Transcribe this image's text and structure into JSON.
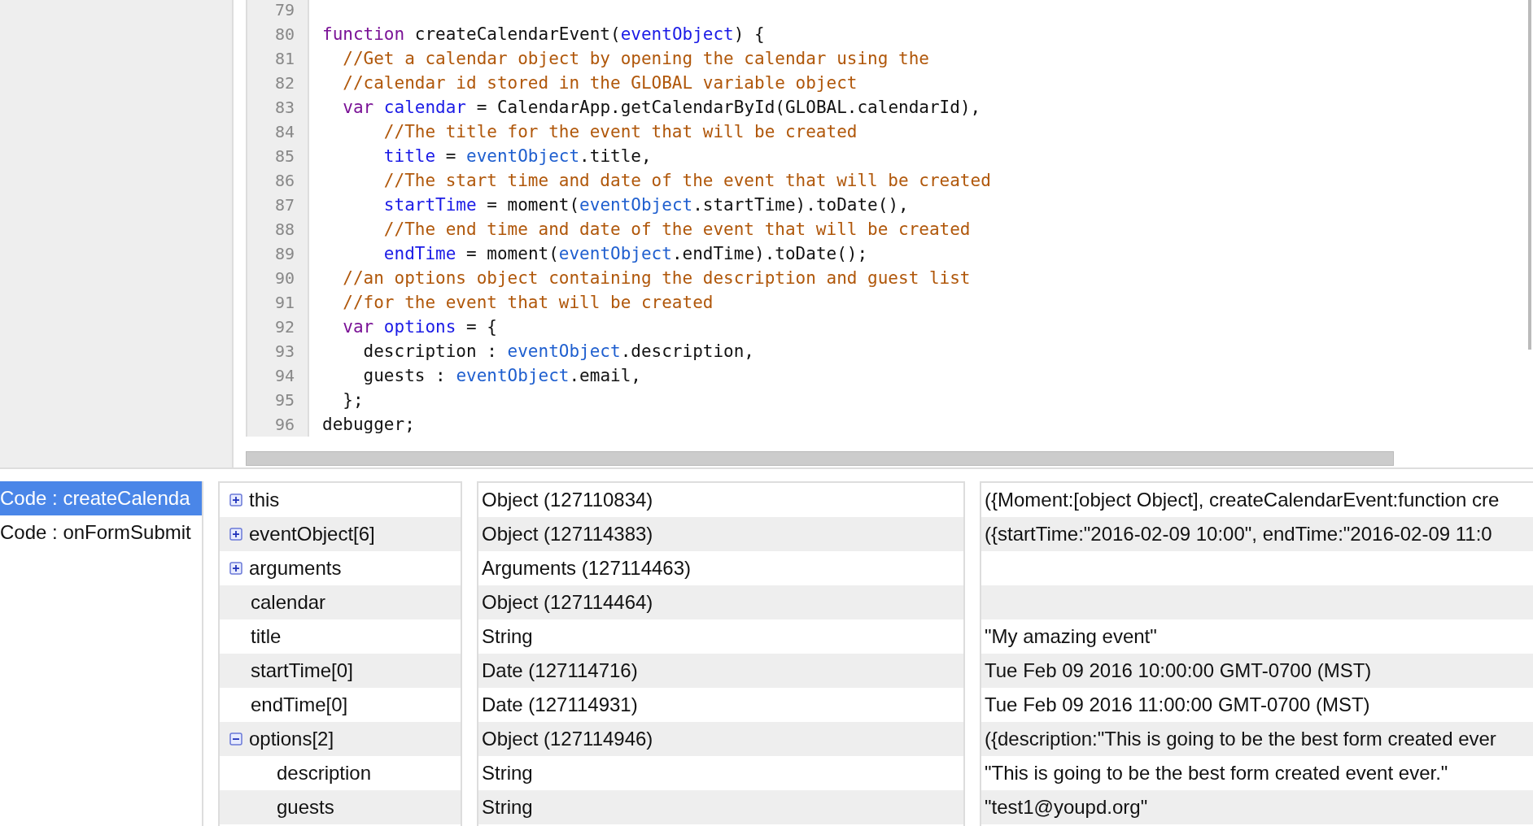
{
  "editor": {
    "lines": [
      {
        "number": "79"
      },
      {
        "number": "80",
        "tokens": [
          {
            "kind": "keyword",
            "text": "function"
          },
          {
            "kind": "plain",
            "text": " createCalendarEvent("
          },
          {
            "kind": "def",
            "text": "eventObject"
          },
          {
            "kind": "plain",
            "text": ") {"
          }
        ]
      },
      {
        "number": "81",
        "tokens": [
          {
            "kind": "comment",
            "text": "  //Get a calendar object by opening the calendar using the"
          }
        ]
      },
      {
        "number": "82",
        "tokens": [
          {
            "kind": "comment",
            "text": "  //calendar id stored in the GLOBAL variable object"
          }
        ]
      },
      {
        "number": "83",
        "tokens": [
          {
            "kind": "keyword",
            "text": "  var"
          },
          {
            "kind": "def",
            "text": " calendar"
          },
          {
            "kind": "plain",
            "text": " = CalendarApp.getCalendarById(GLOBAL.calendarId),"
          }
        ]
      },
      {
        "number": "84",
        "tokens": [
          {
            "kind": "comment",
            "text": "      //The title for the event that will be created"
          }
        ]
      },
      {
        "number": "85",
        "tokens": [
          {
            "kind": "def",
            "text": "      title"
          },
          {
            "kind": "plain",
            "text": " = "
          },
          {
            "kind": "var",
            "text": "eventObject"
          },
          {
            "kind": "plain",
            "text": ".title,"
          }
        ]
      },
      {
        "number": "86",
        "tokens": [
          {
            "kind": "comment",
            "text": "      //The start time and date of the event that will be created"
          }
        ]
      },
      {
        "number": "87",
        "tokens": [
          {
            "kind": "def",
            "text": "      startTime"
          },
          {
            "kind": "plain",
            "text": " = moment("
          },
          {
            "kind": "var",
            "text": "eventObject"
          },
          {
            "kind": "plain",
            "text": ".startTime).toDate(),"
          }
        ]
      },
      {
        "number": "88",
        "tokens": [
          {
            "kind": "comment",
            "text": "      //The end time and date of the event that will be created"
          }
        ]
      },
      {
        "number": "89",
        "tokens": [
          {
            "kind": "def",
            "text": "      endTime"
          },
          {
            "kind": "plain",
            "text": " = moment("
          },
          {
            "kind": "var",
            "text": "eventObject"
          },
          {
            "kind": "plain",
            "text": ".endTime).toDate();"
          }
        ]
      },
      {
        "number": "90",
        "tokens": [
          {
            "kind": "comment",
            "text": "  //an options object containing the description and guest list"
          }
        ]
      },
      {
        "number": "91",
        "tokens": [
          {
            "kind": "comment",
            "text": "  //for the event that will be created"
          }
        ]
      },
      {
        "number": "92",
        "tokens": [
          {
            "kind": "keyword",
            "text": "  var"
          },
          {
            "kind": "def",
            "text": " options"
          },
          {
            "kind": "plain",
            "text": " = {"
          }
        ]
      },
      {
        "number": "93",
        "tokens": [
          {
            "kind": "plain",
            "text": "    description : "
          },
          {
            "kind": "var",
            "text": "eventObject"
          },
          {
            "kind": "plain",
            "text": ".description,"
          }
        ]
      },
      {
        "number": "94",
        "tokens": [
          {
            "kind": "plain",
            "text": "    guests : "
          },
          {
            "kind": "var",
            "text": "eventObject"
          },
          {
            "kind": "plain",
            "text": ".email,"
          }
        ]
      },
      {
        "number": "95",
        "tokens": [
          {
            "kind": "plain",
            "text": "  };"
          }
        ]
      },
      {
        "number": "96",
        "tokens": [
          {
            "kind": "plain",
            "text": "debugger;"
          }
        ]
      }
    ]
  },
  "call_stack": [
    {
      "label": "Code : createCalenda",
      "selected": true
    },
    {
      "label": "Code : onFormSubmit",
      "selected": false
    }
  ],
  "variables": [
    {
      "name": "this",
      "kind": "expandable",
      "expanded": false,
      "type": "Object (127110834)",
      "value": "({Moment:[object Object], createCalendarEvent:function cre"
    },
    {
      "name": "eventObject[6]",
      "kind": "expandable",
      "expanded": false,
      "type": "Object (127114383)",
      "value": "({startTime:\"2016-02-09 10:00\", endTime:\"2016-02-09 11:0"
    },
    {
      "name": "arguments",
      "kind": "expandable",
      "expanded": false,
      "type": "Arguments (127114463)"
    },
    {
      "name": "calendar",
      "kind": "plain",
      "type": "Object (127114464)"
    },
    {
      "name": "title",
      "kind": "plain",
      "type": "String",
      "value": "\"My amazing event\""
    },
    {
      "name": "startTime[0]",
      "kind": "plain",
      "type": "Date (127114716)",
      "value": "Tue Feb 09 2016 10:00:00 GMT-0700 (MST)"
    },
    {
      "name": "endTime[0]",
      "kind": "plain",
      "type": "Date (127114931)",
      "value": "Tue Feb 09 2016 11:00:00 GMT-0700 (MST)"
    },
    {
      "name": "options[2]",
      "kind": "expandable",
      "expanded": true,
      "type": "Object (127114946)",
      "value": "({description:\"This is going to be the best form created ever",
      "children": [
        {
          "name": "description",
          "kind": "plain",
          "type": "String",
          "value": "\"This is going to be the best form created event ever.\""
        },
        {
          "name": "guests",
          "kind": "plain",
          "type": "String",
          "value": "\"test1@youpd.org\""
        }
      ]
    }
  ]
}
